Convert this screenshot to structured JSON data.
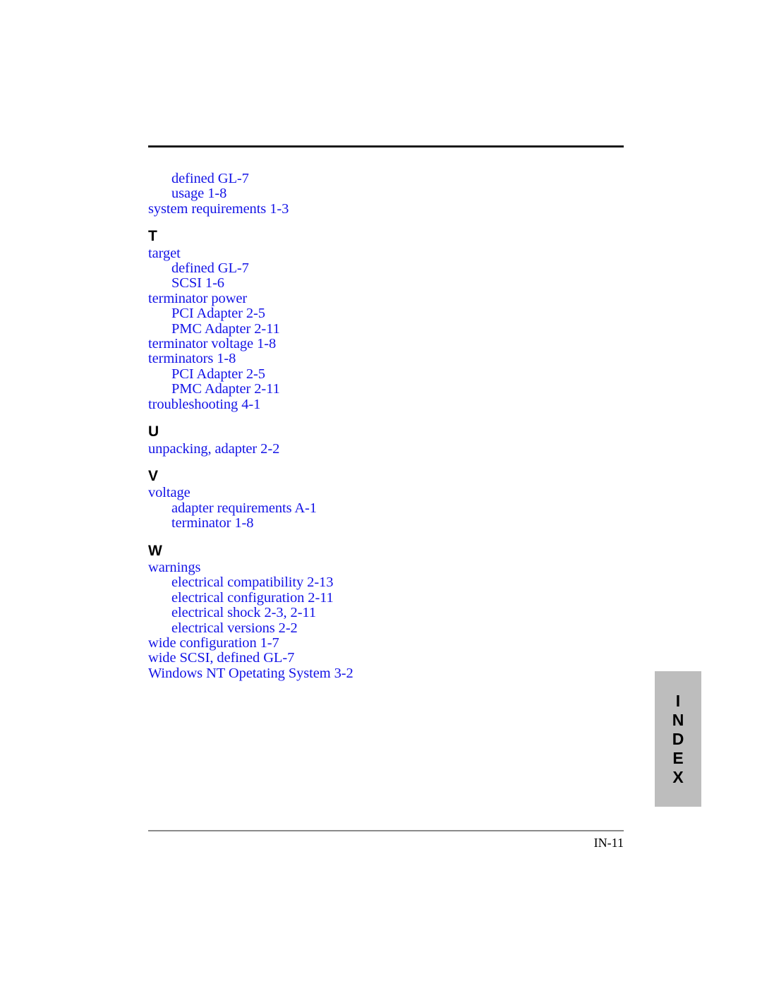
{
  "page": {
    "number_label": "IN-11",
    "text_color": "#1414e6",
    "heading_color": "#000000",
    "tab_background": "#bdbdbd",
    "rule_color_top": "#1a1a1a",
    "rule_color_bottom": "#8a8a8a"
  },
  "side_tab": {
    "name": "INDEX",
    "letters": [
      "I",
      "N",
      "D",
      "E",
      "X"
    ]
  },
  "index": {
    "continued_entries": [
      {
        "level": 1,
        "text": "defined GL-7"
      },
      {
        "level": 1,
        "text": "usage 1-8"
      },
      {
        "level": 0,
        "text": "system requirements 1-3"
      }
    ],
    "sections": [
      {
        "letter": "T",
        "entries": [
          {
            "level": 0,
            "text": "target"
          },
          {
            "level": 1,
            "text": "defined GL-7"
          },
          {
            "level": 1,
            "text": "SCSI 1-6"
          },
          {
            "level": 0,
            "text": "terminator power"
          },
          {
            "level": 1,
            "text": "PCI Adapter 2-5"
          },
          {
            "level": 1,
            "text": "PMC Adapter 2-11"
          },
          {
            "level": 0,
            "text": "terminator voltage 1-8"
          },
          {
            "level": 0,
            "text": "terminators 1-8"
          },
          {
            "level": 1,
            "text": "PCI Adapter 2-5"
          },
          {
            "level": 1,
            "text": "PMC Adapter 2-11"
          },
          {
            "level": 0,
            "text": "troubleshooting 4-1"
          }
        ]
      },
      {
        "letter": "U",
        "entries": [
          {
            "level": 0,
            "text": "unpacking, adapter 2-2"
          }
        ]
      },
      {
        "letter": "V",
        "entries": [
          {
            "level": 0,
            "text": "voltage"
          },
          {
            "level": 1,
            "text": "adapter requirements A-1"
          },
          {
            "level": 1,
            "text": "terminator 1-8"
          }
        ]
      },
      {
        "letter": "W",
        "entries": [
          {
            "level": 0,
            "text": "warnings"
          },
          {
            "level": 1,
            "text": "electrical compatibility 2-13"
          },
          {
            "level": 1,
            "text": "electrical configuration 2-11"
          },
          {
            "level": 1,
            "text": "electrical shock 2-3, 2-11"
          },
          {
            "level": 1,
            "text": "electrical versions 2-2"
          },
          {
            "level": 0,
            "text": "wide configuration 1-7"
          },
          {
            "level": 0,
            "text": "wide SCSI, defined GL-7"
          },
          {
            "level": 0,
            "text": "Windows NT Opetating System 3-2"
          }
        ]
      }
    ]
  }
}
